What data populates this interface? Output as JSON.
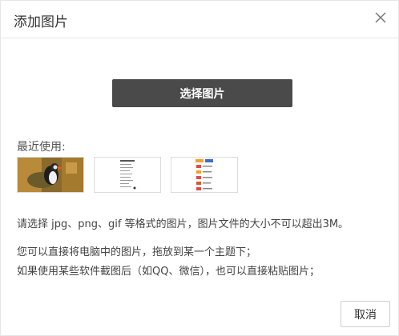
{
  "dialog": {
    "title": "添加图片",
    "select_button": "选择图片",
    "recent_label": "最近使用:",
    "recent_images": [
      {
        "icon": "puffin-photo-icon"
      },
      {
        "icon": "document-screenshot-icon"
      },
      {
        "icon": "colorful-list-screenshot-icon"
      }
    ],
    "format_hint": "请选择 jpg、png、gif 等格式的图片，图片文件的大小不可以超出3M。",
    "drag_hint": "您可以直接将电脑中的图片，拖放到某一个主题下；",
    "paste_hint": "如果使用某些软件截图后（如QQ、微信），也可以直接粘贴图片；",
    "cancel_button": "取消"
  }
}
